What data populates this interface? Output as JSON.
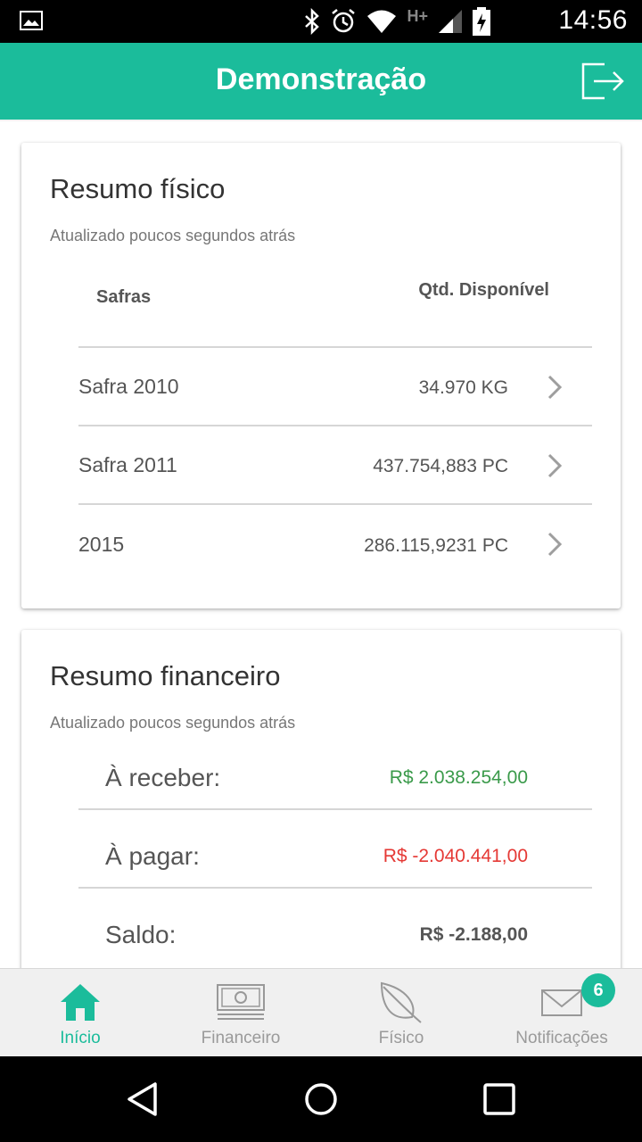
{
  "status_bar": {
    "time": "14:56",
    "network": "H+",
    "icons": [
      "image-icon",
      "bluetooth-icon",
      "alarm-icon",
      "wifi-icon",
      "signal-icon",
      "battery-icon"
    ]
  },
  "app_bar": {
    "title": "Demonstração",
    "logout_icon": "logout-icon"
  },
  "resumo_fisico": {
    "title": "Resumo físico",
    "updated": "Atualizado poucos segundos atrás",
    "col_safras": "Safras",
    "col_qtd": "Qtd. Disponível",
    "rows": [
      {
        "safra": "Safra 2010",
        "qtd": "34.970 KG"
      },
      {
        "safra": "Safra 2011",
        "qtd": "437.754,883 PC"
      },
      {
        "safra": "2015",
        "qtd": "286.115,9231 PC"
      }
    ]
  },
  "resumo_financeiro": {
    "title": "Resumo financeiro",
    "updated": "Atualizado poucos segundos atrás",
    "receber_label": "À receber:",
    "receber_value": "R$ 2.038.254,00",
    "pagar_label": "À pagar:",
    "pagar_value": "R$ -2.040.441,00",
    "saldo_label": "Saldo:",
    "saldo_value": "R$ -2.188,00"
  },
  "bottom_nav": {
    "items": [
      {
        "label": "Início",
        "icon": "home-icon",
        "active": true
      },
      {
        "label": "Financeiro",
        "icon": "money-icon",
        "active": false
      },
      {
        "label": "Físico",
        "icon": "leaf-icon",
        "active": false
      },
      {
        "label": "Notificações",
        "icon": "envelope-icon",
        "active": false
      }
    ],
    "notifications_badge": "6"
  },
  "colors": {
    "accent": "#1bbc9b",
    "positive": "#3a9a4a",
    "negative": "#e53935"
  }
}
